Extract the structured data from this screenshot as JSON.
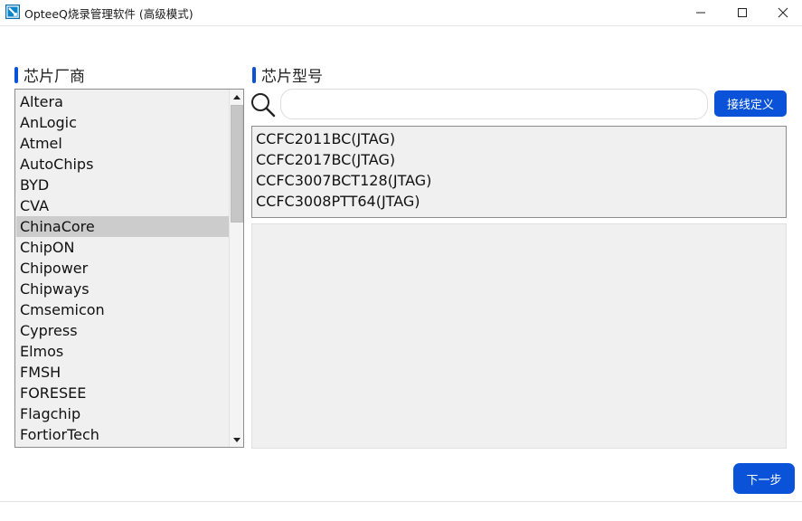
{
  "window": {
    "title": "OpteeQ烧录管理软件 (高级模式)",
    "controls": {
      "minimize": "minimize-icon",
      "maximize": "maximize-icon",
      "close": "close-icon"
    }
  },
  "vendor_section": {
    "header": "芯片厂商",
    "items": [
      "Altera",
      "AnLogic",
      "Atmel",
      "AutoChips",
      "BYD",
      "CVA",
      "ChinaCore",
      "ChipON",
      "Chipower",
      "Chipways",
      "Cmsemicon",
      "Cypress",
      "Elmos",
      "FMSH",
      "FORESEE",
      "Flagchip",
      "FortiorTech"
    ],
    "selected": "ChinaCore"
  },
  "model_section": {
    "header": "芯片型号",
    "search": {
      "value": "",
      "placeholder": ""
    },
    "wiring_button": "接线定义",
    "items": [
      "CCFC2011BC(JTAG)",
      "CCFC2017BC(JTAG)",
      "CCFC3007BCT128(JTAG)",
      "CCFC3008PTT64(JTAG)"
    ]
  },
  "footer": {
    "next_button": "下一步"
  },
  "colors": {
    "accent": "#0a53d9",
    "list_bg": "#f0f0f0",
    "selected_bg": "#cccccc"
  }
}
